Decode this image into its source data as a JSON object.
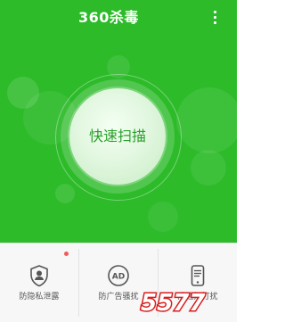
{
  "app": {
    "title_brand": "360",
    "title_text": "杀毒"
  },
  "hero": {
    "scan_button_label": "快速扫描",
    "colors": {
      "background": "#2dbb2a",
      "scan_text": "#2aa02a"
    },
    "menu_icon": "more-vertical-icon"
  },
  "tools": [
    {
      "label": "防隐私泄露",
      "icon": "shield-user-icon",
      "badge": true
    },
    {
      "label": "防广告骚扰",
      "icon": "ad-icon",
      "badge": false
    },
    {
      "label": "防通知打扰",
      "icon": "phone-icon",
      "badge": false
    }
  ],
  "watermark": {
    "text": "5577"
  }
}
